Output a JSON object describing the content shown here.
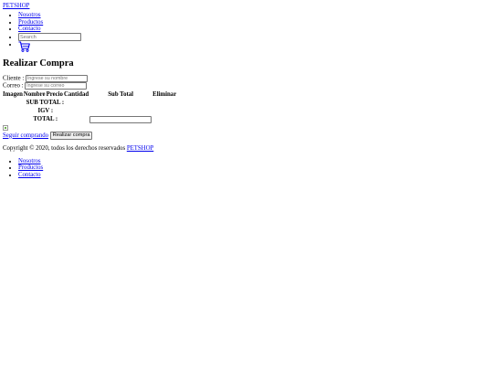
{
  "header": {
    "brand": "PETSHOP",
    "nav": [
      "Nosotros",
      "Productos",
      "Contacto"
    ],
    "search_placeholder": "Search",
    "cart_icon": "shopping-cart-icon"
  },
  "main": {
    "title": "Realizar Compra",
    "cliente_label": "Cliente :",
    "cliente_placeholder": "Ingrese su nombre",
    "correo_label": "Correo :",
    "correo_placeholder": "Ingrese su correo",
    "table": {
      "columns": [
        "Imagen",
        "Nombre",
        "Precio",
        "Cantidad",
        "Sub Total",
        "Eliminar"
      ],
      "subtotal_label": "SUB TOTAL :",
      "igv_label": "IGV :",
      "total_label": "TOTAL :",
      "total_value": ""
    },
    "seguir_link": "Seguir comprando",
    "realizar_button": "Realizar compra"
  },
  "footer": {
    "copyright": "Copyright © 2020, todos los derechos reservados",
    "brand_link": "PETSHOP",
    "nav": [
      "Nosotros",
      "Productos",
      "Contacto"
    ]
  }
}
